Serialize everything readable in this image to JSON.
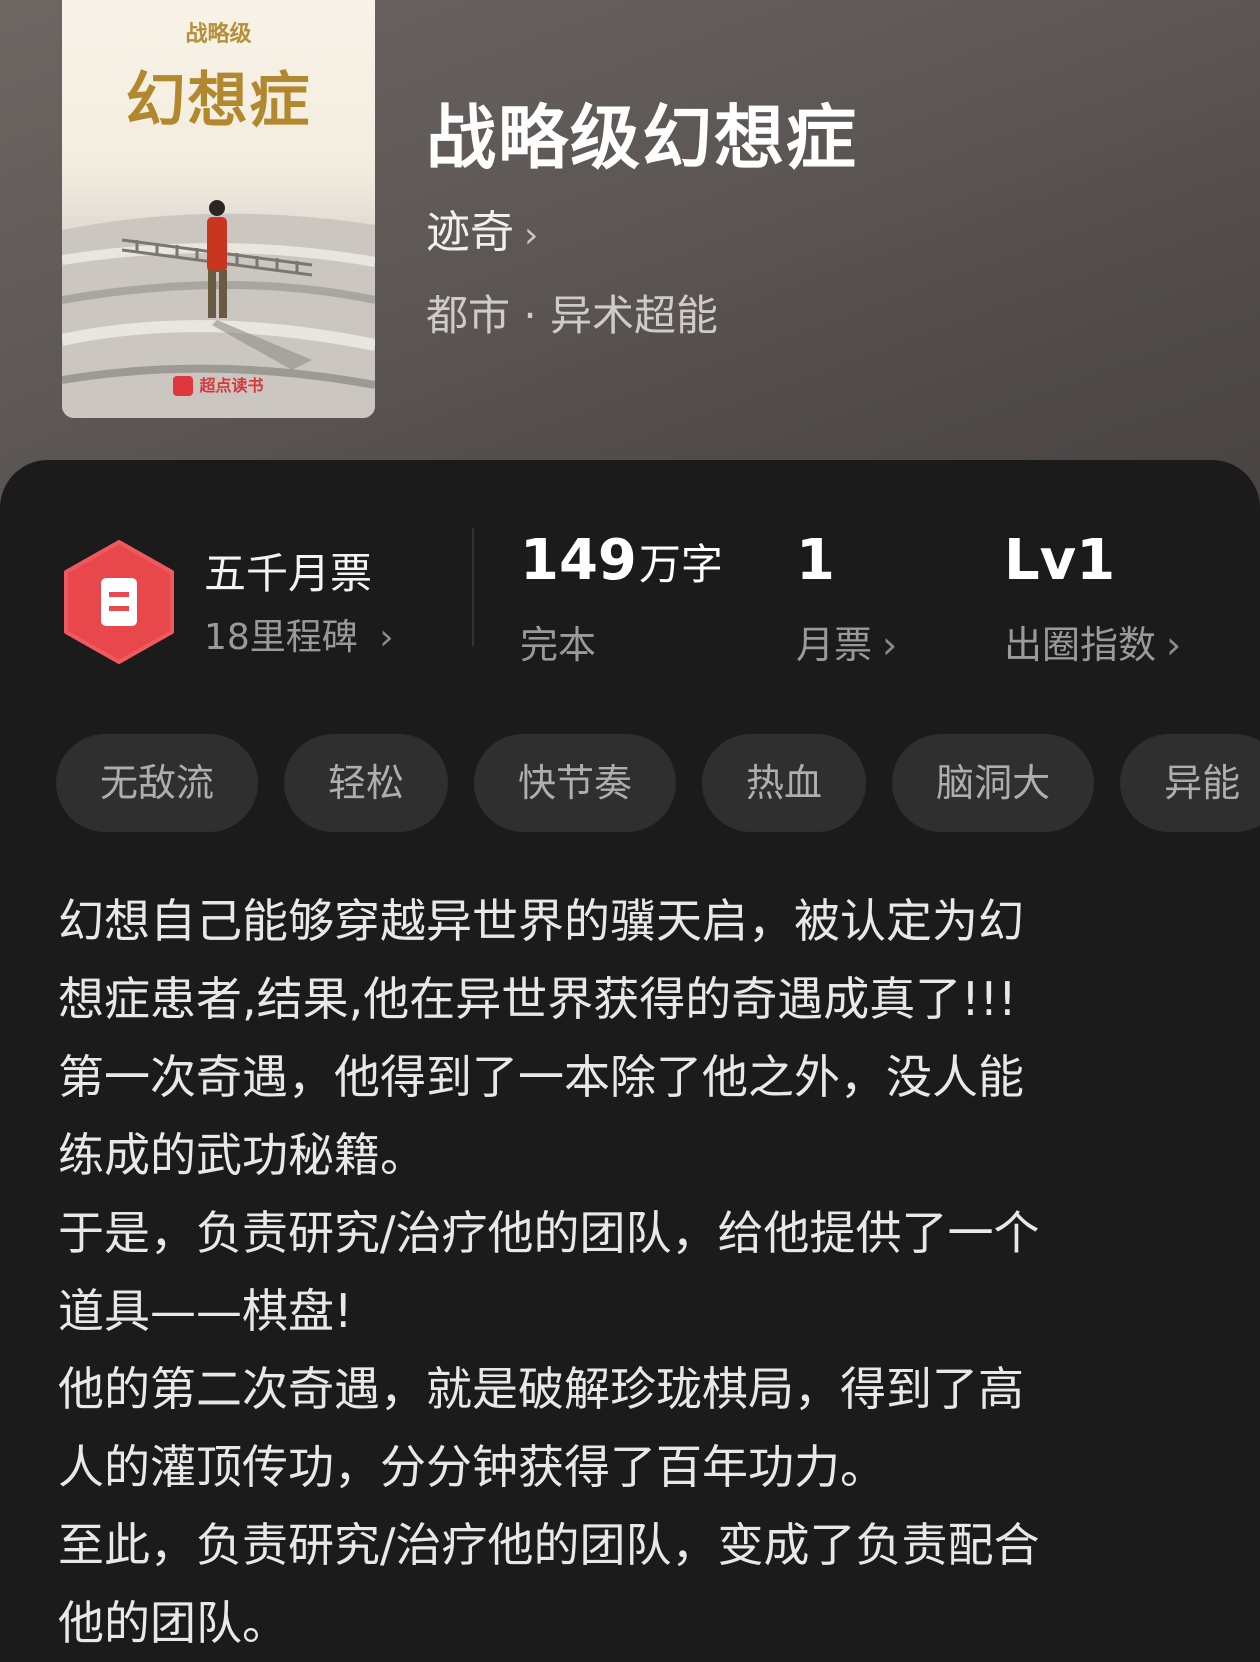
{
  "book": {
    "cover_small_title": "战略级",
    "cover_big_title": "幻想症",
    "cover_brand": "超点读书",
    "title": "战略级幻想症",
    "author": "迹奇",
    "genre": "都市 · 异术超能"
  },
  "stats": {
    "badge_title": "五千月票",
    "badge_sub": "18里程碑",
    "words_value": "149",
    "words_unit": "万字",
    "words_label": "完本",
    "votes_value": "1",
    "votes_label": "月票",
    "level_value": "Lv1",
    "level_label": "出圈指数"
  },
  "tags": [
    "无敌流",
    "轻松",
    "快节奏",
    "热血",
    "脑洞大",
    "异能"
  ],
  "description": [
    "幻想自己能够穿越异世界的骥天启，被认定为幻",
    "想症患者,结果,他在异世界获得的奇遇成真了!!!",
    "第一次奇遇，他得到了一本除了他之外，没人能",
    "练成的武功秘籍。",
    "于是，负责研究/治疗他的团队，给他提供了一个",
    "道具——棋盘!",
    "他的第二次奇遇，就是破解珍珑棋局，得到了高",
    "人的灌顶传功，分分钟获得了百年功力。",
    "至此，负责研究/治疗他的团队，变成了负责配合",
    "他的团队。"
  ],
  "colors": {
    "badge_red": "#e8474c",
    "panel_bg": "#1b1b1c",
    "tag_bg": "#2f2f30"
  }
}
